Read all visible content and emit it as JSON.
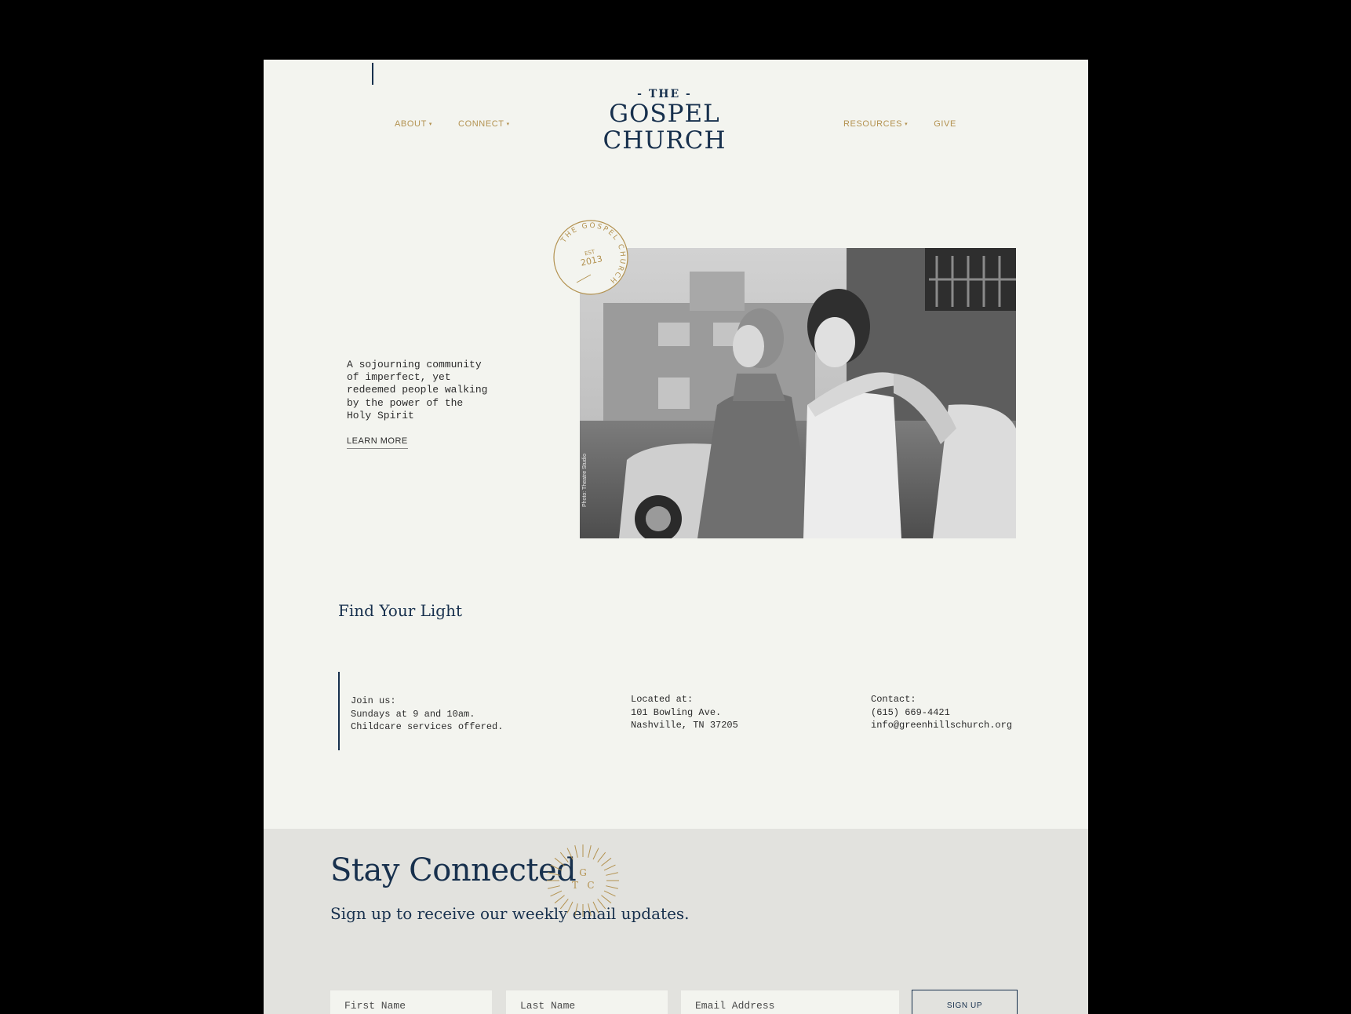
{
  "nav": {
    "left": [
      {
        "label": "ABOUT",
        "caret": "▾"
      },
      {
        "label": "CONNECT",
        "caret": "▾"
      }
    ],
    "right": [
      {
        "label": "RESOURCES",
        "caret": "▾"
      },
      {
        "label": "GIVE",
        "caret": ""
      }
    ]
  },
  "logo": {
    "the": "- THE -",
    "line1": "GOSPEL",
    "line2": "CHURCH"
  },
  "hero": {
    "text": [
      "A sojourning community",
      "of imperfect, yet",
      "redeemed people walking",
      "by the power of the",
      "Holy Spirit"
    ],
    "learn_more": "LEARN MORE",
    "photo_credit": "Photo: Theatre Studio"
  },
  "seal": {
    "ring_text": "THE GOSPEL CHURCH",
    "est": "EST",
    "year": "2013"
  },
  "find": {
    "title": "Find Your Light"
  },
  "info": {
    "join": [
      "Join us:",
      "Sundays at 9 and 10am.",
      "Childcare services offered."
    ],
    "location": [
      "Located at:",
      "101 Bowling Ave.",
      "Nashville, TN 37205"
    ],
    "contact": [
      "Contact:",
      "(615) 669-4421",
      "info@greenhillschurch.org"
    ]
  },
  "stay": {
    "title": "Stay Connected",
    "subtitle": "Sign up to receive our weekly email updates.",
    "burst": {
      "top": "G",
      "left": "T",
      "right": "C"
    }
  },
  "form": {
    "first_name_placeholder": "First Name",
    "last_name_placeholder": "Last Name",
    "email_placeholder": "Email Address",
    "signup_label": "SIGN UP"
  },
  "colors": {
    "navy": "#17304d",
    "gold": "#b39250",
    "paper": "#f3f4ef",
    "band": "#e2e2de"
  }
}
